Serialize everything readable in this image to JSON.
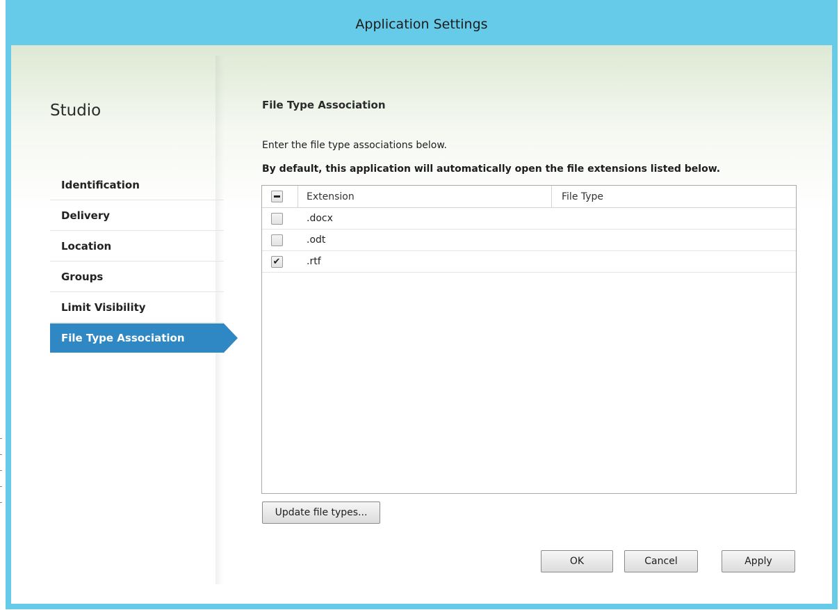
{
  "window": {
    "title": "Application Settings"
  },
  "sidebar": {
    "title": "Studio",
    "items": [
      {
        "label": "Identification"
      },
      {
        "label": "Delivery"
      },
      {
        "label": "Location"
      },
      {
        "label": "Groups"
      },
      {
        "label": "Limit Visibility"
      },
      {
        "label": "File Type Association",
        "active": true
      }
    ]
  },
  "main": {
    "section_title": "File Type Association",
    "description1": "Enter the file type associations below.",
    "description2": "By default, this application will automatically open the file extensions listed below.",
    "table": {
      "columns": [
        "",
        "Extension",
        "File Type"
      ],
      "header_checkbox_state": "indeterminate",
      "rows": [
        {
          "checked": false,
          "extension": ".docx",
          "file_type": ""
        },
        {
          "checked": false,
          "extension": ".odt",
          "file_type": ""
        },
        {
          "checked": true,
          "extension": ".rtf",
          "file_type": ""
        }
      ]
    },
    "update_button": "Update file types..."
  },
  "footer": {
    "ok": "OK",
    "cancel": "Cancel",
    "apply": "Apply"
  },
  "colors": {
    "titlebar": "#66cbe9",
    "active_nav": "#2f88c4"
  }
}
